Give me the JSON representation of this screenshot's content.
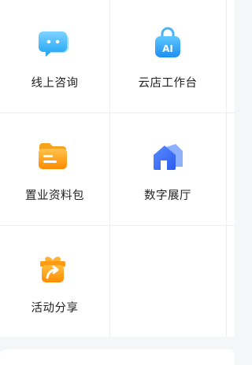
{
  "grid": {
    "items": [
      {
        "label": "线上咨询",
        "icon": "chat-bubble-icon"
      },
      {
        "label": "云店工作台",
        "icon": "ai-bag-icon"
      },
      {
        "label": "置业资料包",
        "icon": "folder-icon"
      },
      {
        "label": "数字展厅",
        "icon": "house-icon"
      },
      {
        "label": "活动分享",
        "icon": "gift-share-icon"
      }
    ]
  },
  "colors": {
    "cyan": "#29b6f6",
    "blue": "#2f7df6",
    "orange": "#ff9f1a",
    "label": "#222222",
    "divider": "#eeeeee"
  }
}
